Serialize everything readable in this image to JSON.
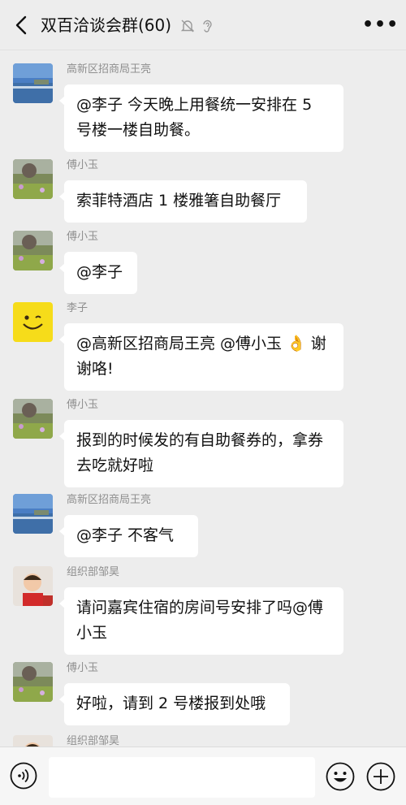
{
  "header": {
    "title": "双百洽谈会群(60)",
    "back_icon": "chevron-left-icon",
    "mute_icon": "bell-off-icon",
    "earpiece_icon": "ear-icon",
    "more_label": "•••"
  },
  "messages": [
    {
      "sender": "高新区招商局王亮",
      "avatar": "lake-landscape",
      "text": "@李子  今天晚上用餐统一安排在 5 号楼一楼自助餐。"
    },
    {
      "sender": "傅小玉",
      "avatar": "flower-field",
      "text": "索菲特酒店 1 楼雅箸自助餐厅"
    },
    {
      "sender": "傅小玉",
      "avatar": "flower-field",
      "text": "@李子"
    },
    {
      "sender": "李子",
      "avatar": "smiley-face",
      "text": "@高新区招商局王亮 @傅小玉 👌 谢谢咯!"
    },
    {
      "sender": "傅小玉",
      "avatar": "flower-field",
      "text": "报到的时候发的有自助餐券的，拿券去吃就好啦"
    },
    {
      "sender": "高新区招商局王亮",
      "avatar": "lake-landscape",
      "text": "@李子  不客气"
    },
    {
      "sender": "组织部邹昊",
      "avatar": "child-photo",
      "text": "请问嘉宾住宿的房间号安排了吗@傅小玉"
    },
    {
      "sender": "傅小玉",
      "avatar": "flower-field",
      "text": "好啦，请到 2 号楼报到处哦"
    },
    {
      "sender": "组织部邹昊",
      "avatar": "child-photo",
      "text": ""
    }
  ],
  "input_bar": {
    "voice_icon": "voice-icon",
    "text_value": "",
    "emoji_icon": "emoji-icon",
    "plus_icon": "plus-circle-icon"
  },
  "colors": {
    "background": "#ededed",
    "bubble": "#ffffff",
    "sender_text": "#8f8f8f",
    "input_bar": "#f6f6f6"
  }
}
